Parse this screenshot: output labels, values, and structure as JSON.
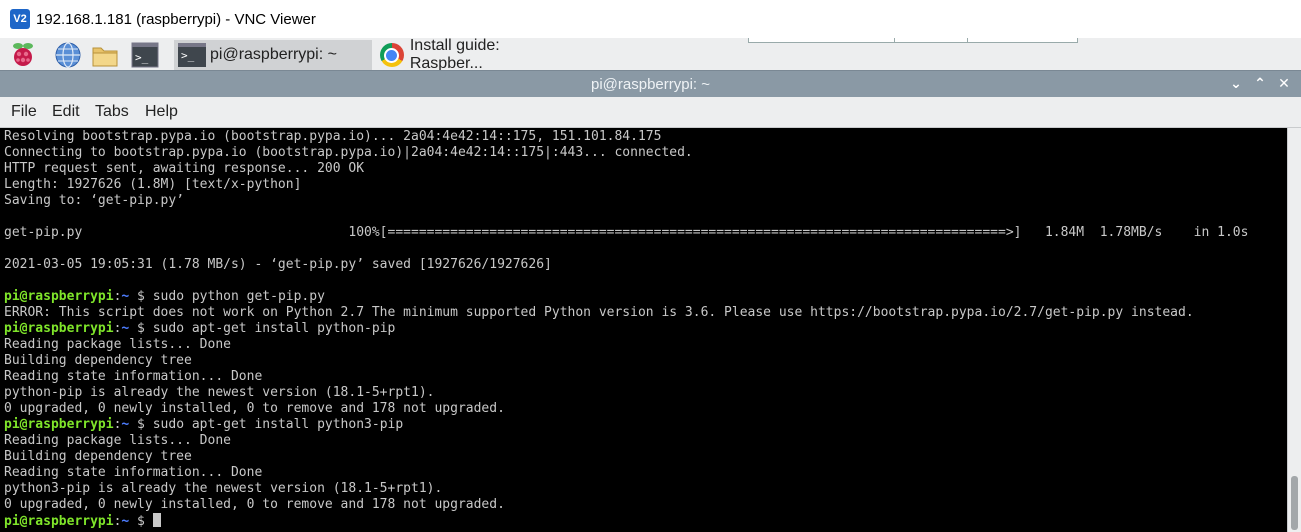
{
  "vnc": {
    "logo": "V2",
    "title": "192.168.1.181 (raspberrypi) - VNC Viewer"
  },
  "taskbar": {
    "launchers": [
      "raspberry-menu-icon",
      "web-browser-icon",
      "file-manager-icon",
      "terminal-icon"
    ],
    "tasks": [
      {
        "label": "pi@raspberrypi: ~",
        "icon": "terminal-icon",
        "active": true
      },
      {
        "label": "Install guide: Raspber...",
        "icon": "chromium-icon",
        "active": false
      }
    ]
  },
  "terminal": {
    "title": "pi@raspberrypi: ~",
    "window_buttons": {
      "minimize": "⌄",
      "maximize": "⌃",
      "close": "✕"
    },
    "menu": [
      "File",
      "Edit",
      "Tabs",
      "Help"
    ],
    "lines": [
      {
        "type": "out",
        "text": "Resolving bootstrap.pypa.io (bootstrap.pypa.io)... 2a04:4e42:14::175, 151.101.84.175"
      },
      {
        "type": "out",
        "text": "Connecting to bootstrap.pypa.io (bootstrap.pypa.io)|2a04:4e42:14::175|:443... connected."
      },
      {
        "type": "out",
        "text": "HTTP request sent, awaiting response... 200 OK"
      },
      {
        "type": "out",
        "text": "Length: 1927626 (1.8M) [text/x-python]"
      },
      {
        "type": "out",
        "text": "Saving to: ‘get-pip.py’"
      },
      {
        "type": "out",
        "text": ""
      },
      {
        "type": "out",
        "text": "get-pip.py                                  100%[===============================================================================>]   1.84M  1.78MB/s    in 1.0s"
      },
      {
        "type": "out",
        "text": ""
      },
      {
        "type": "out",
        "text": "2021-03-05 19:05:31 (1.78 MB/s) - ‘get-pip.py’ saved [1927626/1927626]"
      },
      {
        "type": "out",
        "text": ""
      },
      {
        "type": "cmd",
        "user": "pi@raspberrypi",
        "path": "~",
        "sym": "$",
        "text": " sudo python get-pip.py"
      },
      {
        "type": "out",
        "text": "ERROR: This script does not work on Python 2.7 The minimum supported Python version is 3.6. Please use https://bootstrap.pypa.io/2.7/get-pip.py instead."
      },
      {
        "type": "cmd",
        "user": "pi@raspberrypi",
        "path": "~",
        "sym": "$",
        "text": " sudo apt-get install python-pip"
      },
      {
        "type": "out",
        "text": "Reading package lists... Done"
      },
      {
        "type": "out",
        "text": "Building dependency tree"
      },
      {
        "type": "out",
        "text": "Reading state information... Done"
      },
      {
        "type": "out",
        "text": "python-pip is already the newest version (18.1-5+rpt1)."
      },
      {
        "type": "out",
        "text": "0 upgraded, 0 newly installed, 0 to remove and 178 not upgraded."
      },
      {
        "type": "cmd",
        "user": "pi@raspberrypi",
        "path": "~",
        "sym": "$",
        "text": " sudo apt-get install python3-pip"
      },
      {
        "type": "out",
        "text": "Reading package lists... Done"
      },
      {
        "type": "out",
        "text": "Building dependency tree"
      },
      {
        "type": "out",
        "text": "Reading state information... Done"
      },
      {
        "type": "out",
        "text": "python3-pip is already the newest version (18.1-5+rpt1)."
      },
      {
        "type": "out",
        "text": "0 upgraded, 0 newly installed, 0 to remove and 178 not upgraded."
      },
      {
        "type": "cmd",
        "user": "pi@raspberrypi",
        "path": "~",
        "sym": "$",
        "text": " ",
        "cursor": true
      }
    ]
  },
  "colors": {
    "prompt_user": "#7fe52a",
    "prompt_path": "#4d7dff",
    "terminal_bg": "#000000",
    "terminal_fg": "#c8c8c8",
    "titlebar_bg": "#8a99a5"
  }
}
